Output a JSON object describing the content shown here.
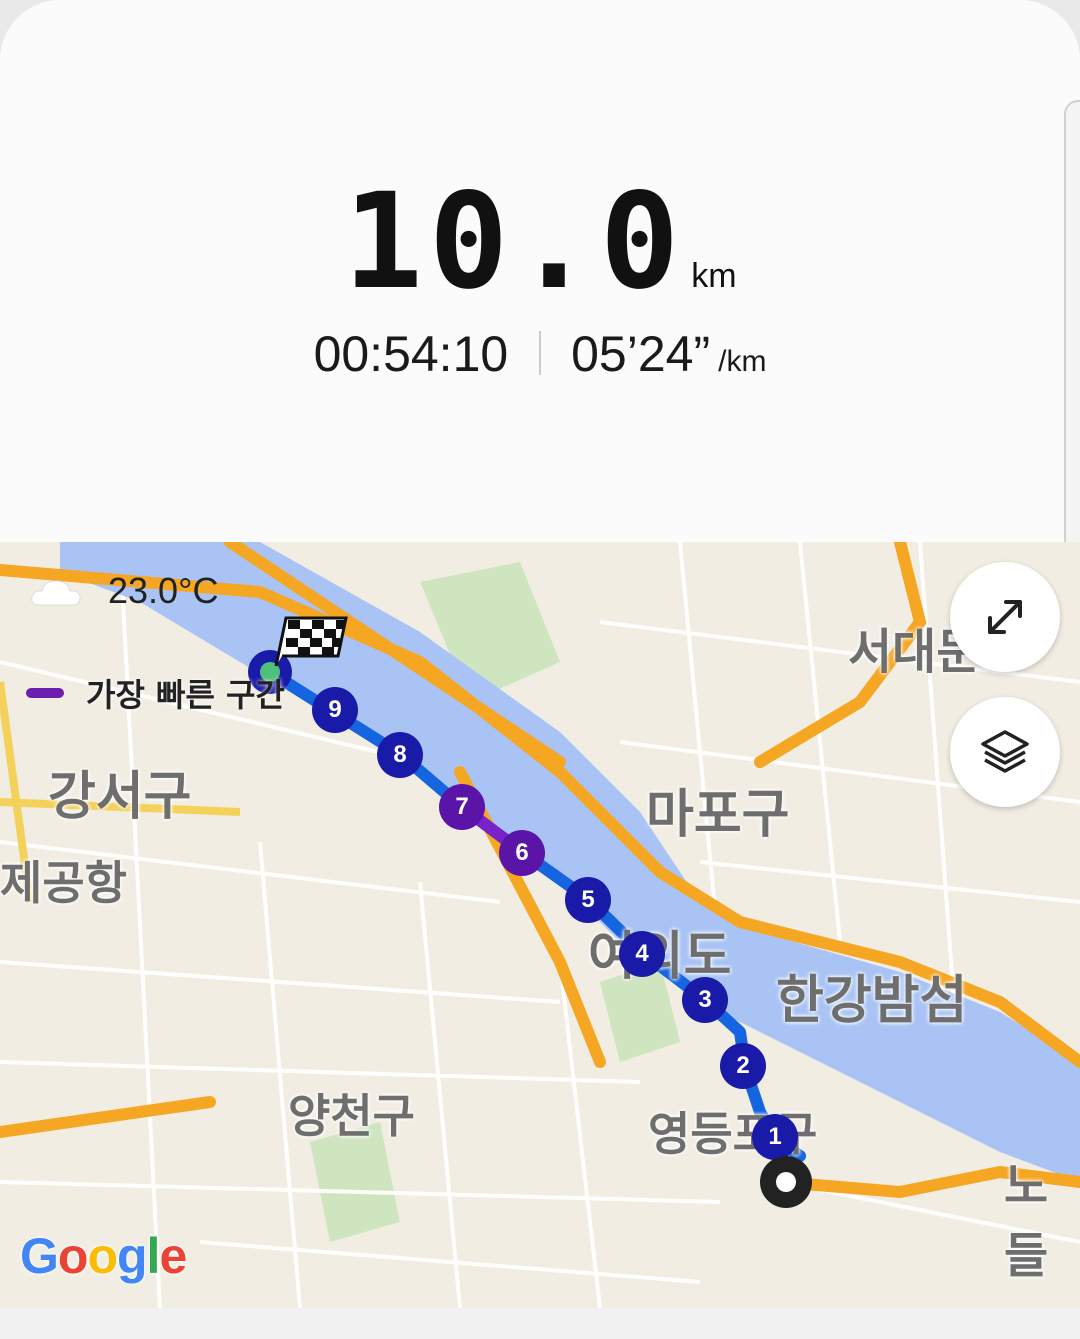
{
  "summary": {
    "distance_value": "10.0",
    "distance_unit": "km",
    "duration": "00:54:10",
    "pace": "05’24”",
    "pace_unit": "/km"
  },
  "map": {
    "weather_icon": "cloud-icon",
    "temperature": "23.0°C",
    "legend_label": "가장 빠른 구간",
    "legend_color": "#6a1fb0",
    "route_color": "#1565e0",
    "marker_color": "#1a1aa8",
    "fastest_marker_color": "#5b14a8",
    "district_labels": [
      "서대문",
      "강서구",
      "제공항",
      "마포구",
      "여의도",
      "한강밤섬",
      "양천구",
      "영등포구",
      "노들"
    ],
    "split_markers": [
      "1",
      "2",
      "3",
      "4",
      "5",
      "6",
      "7",
      "8",
      "9"
    ],
    "fastest_splits": [
      "6",
      "7"
    ],
    "expand_button_icon": "expand-icon",
    "layers_button_icon": "layers-icon",
    "start_icon": "start-marker-icon",
    "finish_icon": "checkered-flag-icon",
    "attribution": "Google"
  }
}
